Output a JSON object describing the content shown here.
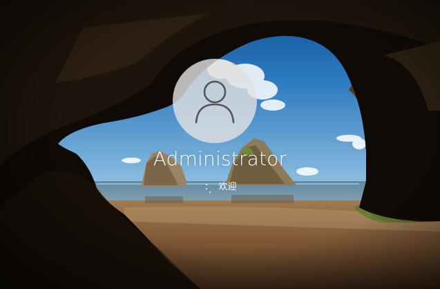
{
  "lock_screen": {
    "user": {
      "name": "Administrator",
      "avatar_icon": "user-silhouette-icon"
    },
    "status": {
      "text": "欢迎",
      "indicator_icon": "loading-spinner-icon"
    }
  },
  "colors": {
    "text": "#ffffff",
    "avatar_bg": "#e1e1e1",
    "avatar_icon": "#555555"
  }
}
